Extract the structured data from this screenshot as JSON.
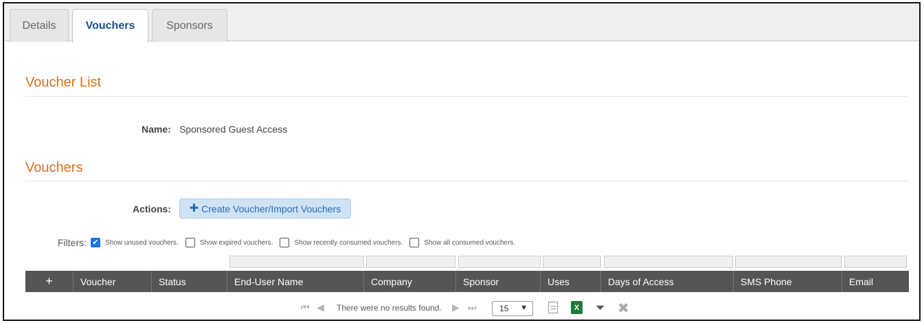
{
  "tabs": [
    {
      "label": "Details"
    },
    {
      "label": "Vouchers"
    },
    {
      "label": "Sponsors"
    }
  ],
  "voucher_list": {
    "title": "Voucher List",
    "name_label": "Name:",
    "name_value": "Sponsored Guest Access"
  },
  "vouchers": {
    "title": "Vouchers",
    "actions_label": "Actions:",
    "create_button": "Create Voucher/Import Vouchers"
  },
  "filters": {
    "label": "Filters:",
    "options": [
      {
        "label": "Show unused vouchers.",
        "checked": true
      },
      {
        "label": "Show expired vouchers.",
        "checked": false
      },
      {
        "label": "Show recently consumed vouchers.",
        "checked": false
      },
      {
        "label": "Show all consumed vouchers.",
        "checked": false
      }
    ]
  },
  "table": {
    "add_symbol": "+",
    "columns": [
      "Voucher",
      "Status",
      "End-User Name",
      "Company",
      "Sponsor",
      "Uses",
      "Days of Access",
      "SMS Phone",
      "Email"
    ]
  },
  "pager": {
    "empty_message": "There were no results found.",
    "page_size": "15"
  }
}
